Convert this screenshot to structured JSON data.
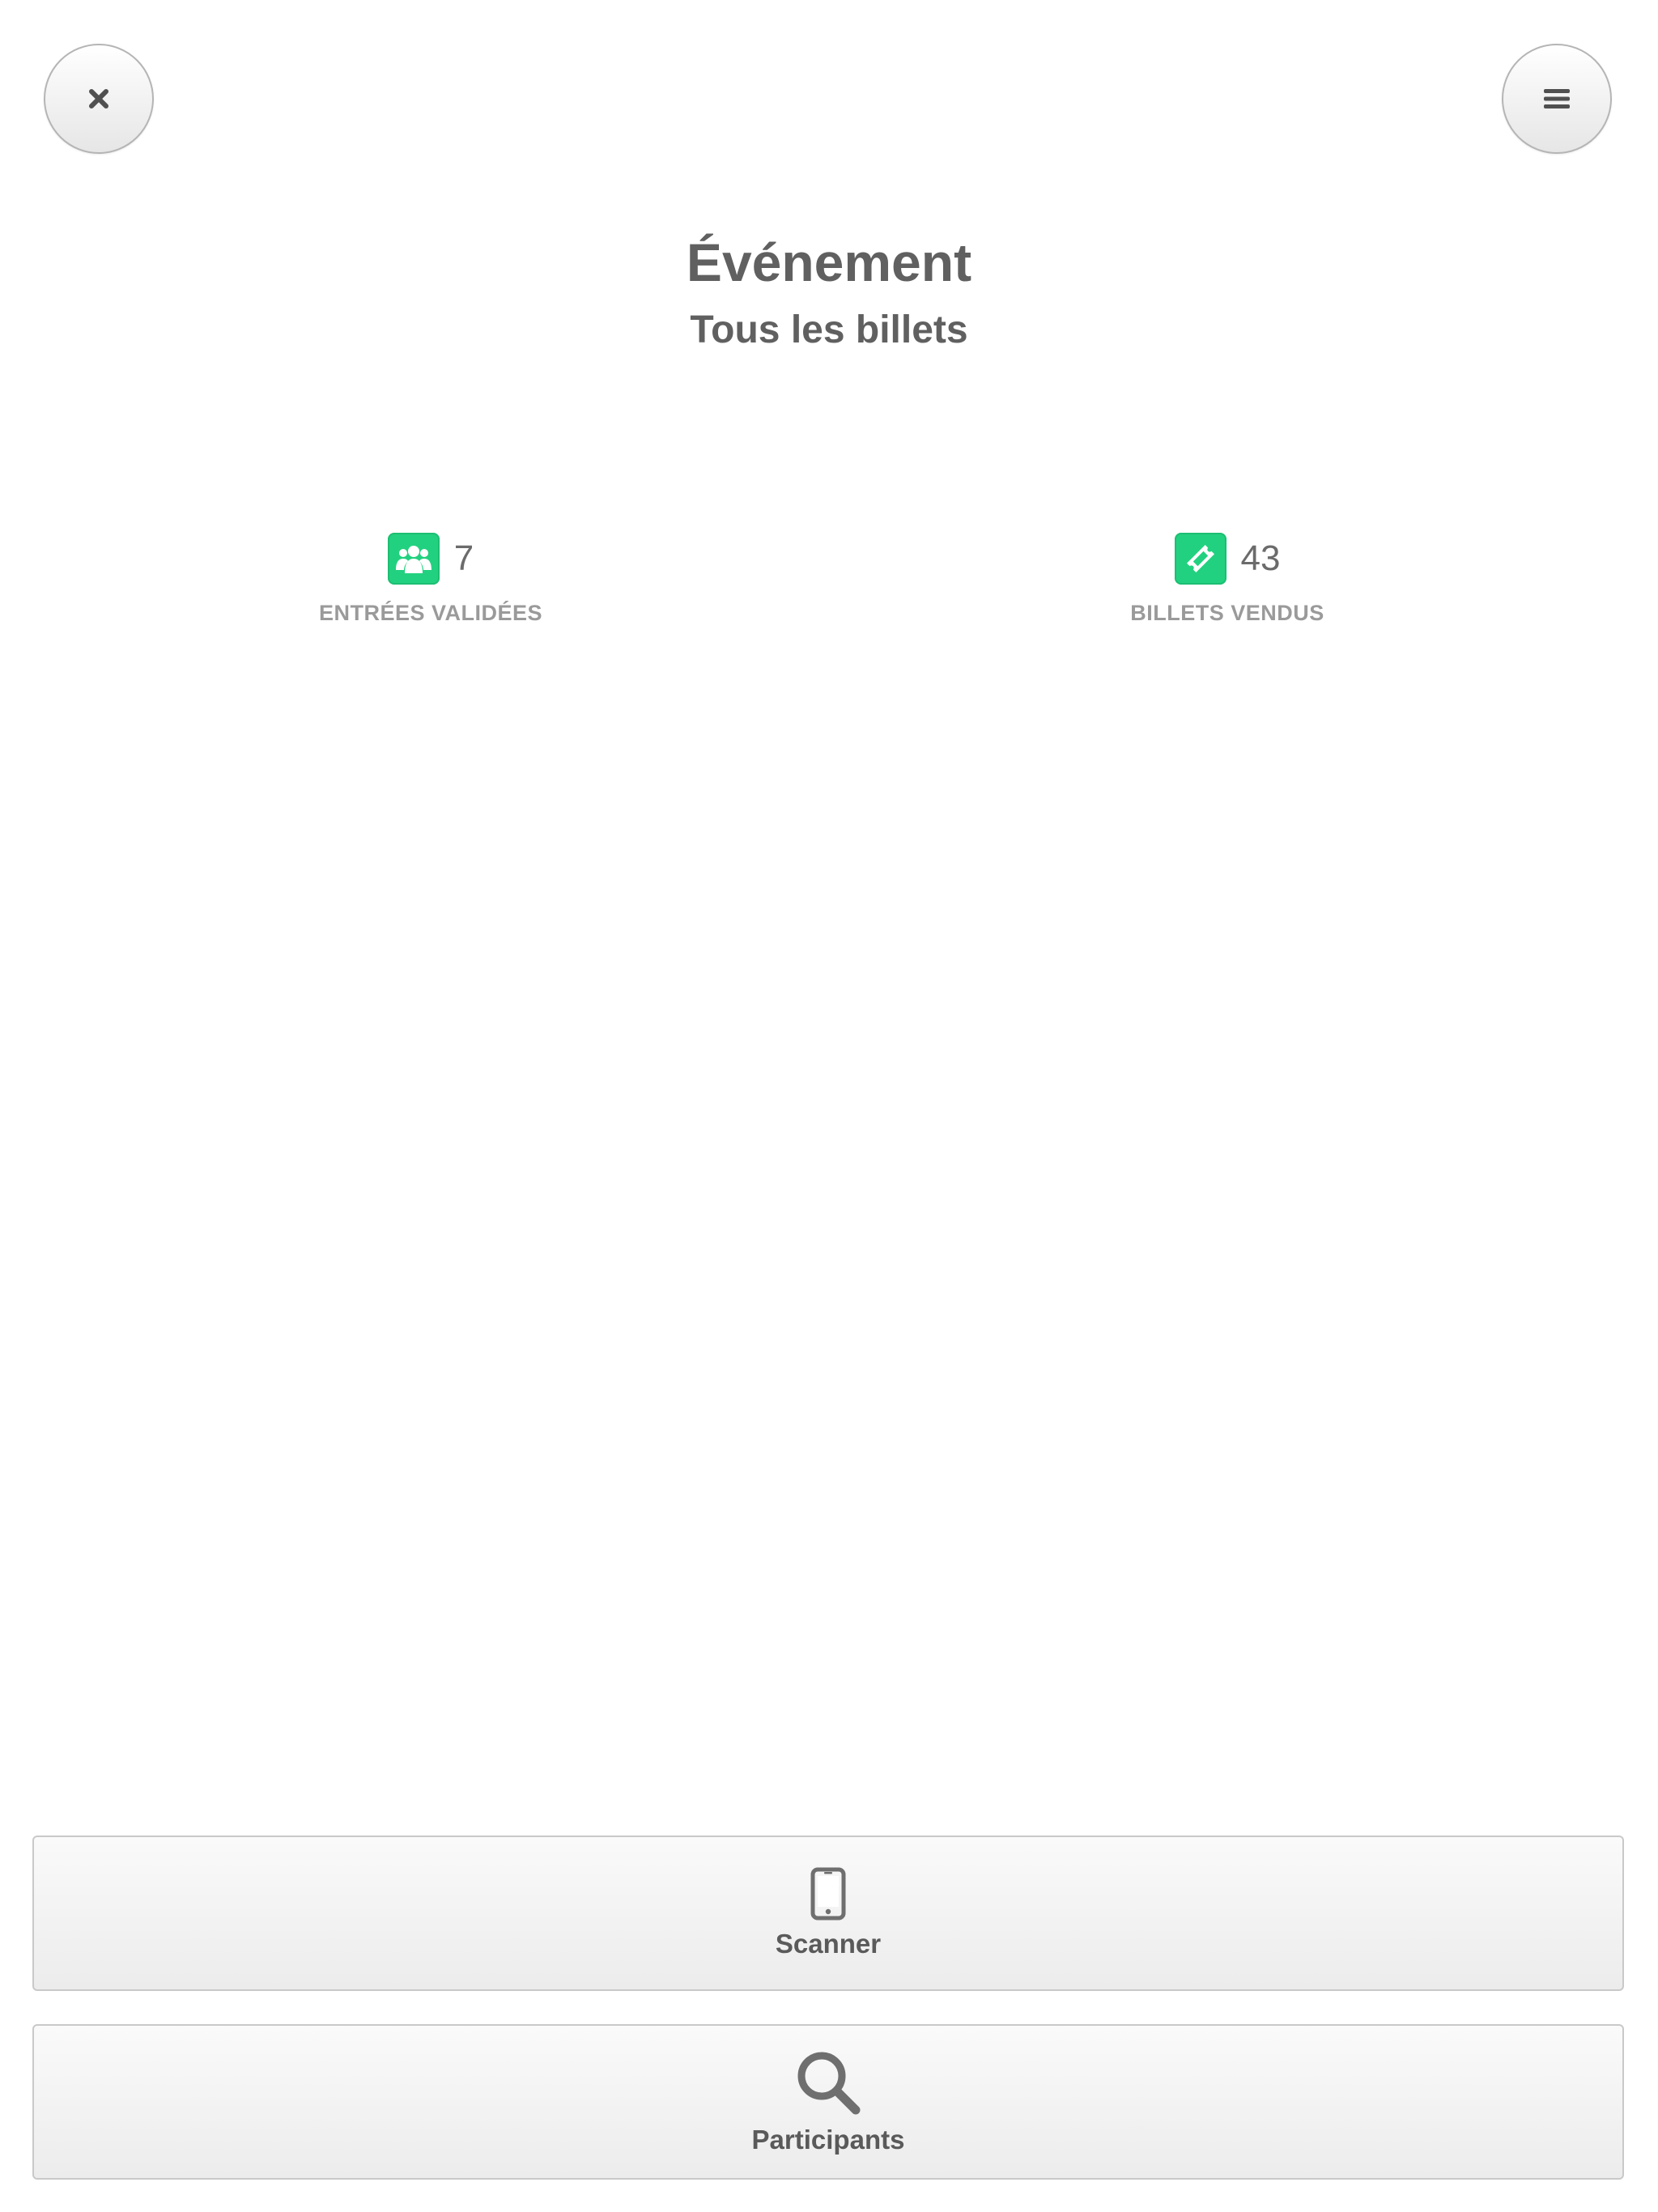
{
  "header": {
    "title": "Événement",
    "subtitle": "Tous les billets"
  },
  "top_bar": {
    "close_icon": "close-icon",
    "menu_icon": "hamburger-menu-icon"
  },
  "stats": [
    {
      "icon": "users-icon",
      "value": "7",
      "label": "ENTRÉES VALIDÉES"
    },
    {
      "icon": "ticket-icon",
      "value": "43",
      "label": "BILLETS VENDUS"
    }
  ],
  "actions": {
    "scanner": {
      "icon": "mobile-phone-icon",
      "label": "Scanner"
    },
    "participants": {
      "icon": "search-icon",
      "label": "Participants"
    }
  },
  "colors": {
    "accent_green": "#22d17f",
    "text_dark": "#606060",
    "text_muted": "#9a9a9a"
  }
}
